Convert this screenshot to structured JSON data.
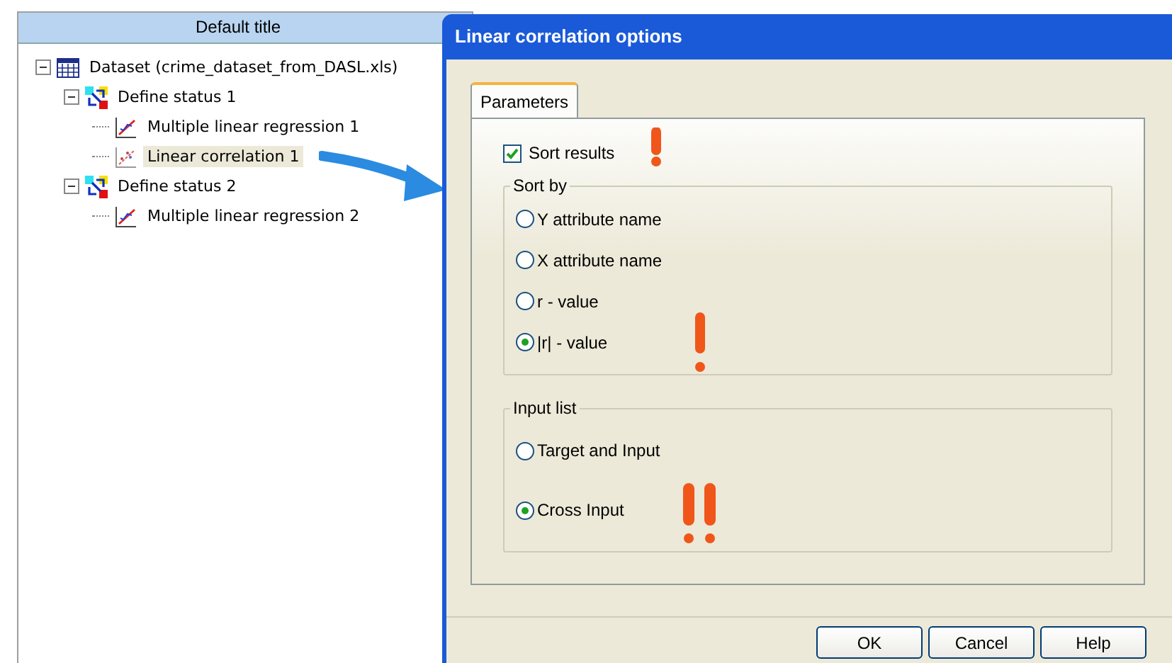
{
  "tree_panel": {
    "header": "Default title",
    "tree": [
      {
        "label": "Dataset (crime_dataset_from_DASL.xls)",
        "kind": "dataset",
        "expanded": true,
        "selected": false,
        "children": [
          {
            "label": "Define status 1",
            "kind": "status",
            "expanded": true,
            "selected": false,
            "children": [
              {
                "label": "Multiple linear regression 1",
                "kind": "regression",
                "selected": false
              },
              {
                "label": "Linear correlation 1",
                "kind": "correlation",
                "selected": true
              }
            ]
          },
          {
            "label": "Define status 2",
            "kind": "status",
            "expanded": true,
            "selected": false,
            "children": [
              {
                "label": "Multiple linear regression 2",
                "kind": "regression",
                "selected": false
              }
            ]
          }
        ]
      }
    ]
  },
  "dialog": {
    "title": "Linear correlation options",
    "tabs": [
      {
        "label": "Parameters",
        "selected": true
      }
    ],
    "sort_results": {
      "label": "Sort results",
      "checked": true
    },
    "groups": [
      {
        "title": "Sort by",
        "options": [
          {
            "label": "Y attribute name",
            "selected": false
          },
          {
            "label": "X attribute name",
            "selected": false
          },
          {
            "label": "r - value",
            "selected": false
          },
          {
            "label": "|r| - value",
            "selected": true
          }
        ]
      },
      {
        "title": "Input list",
        "options": [
          {
            "label": "Target and Input",
            "selected": false
          },
          {
            "label": "Cross Input",
            "selected": true
          }
        ]
      }
    ],
    "buttons": [
      "OK",
      "Cancel",
      "Help"
    ]
  }
}
